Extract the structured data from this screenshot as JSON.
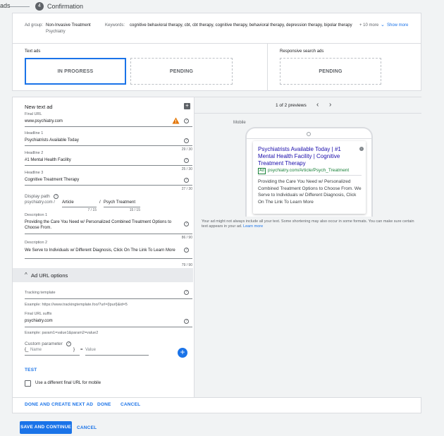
{
  "stepper": {
    "prefix": "ads",
    "step_number": "4",
    "step_label": "Confirmation"
  },
  "ad_group": {
    "label": "Ad group:",
    "name_line1": "Non-Invasive Treatment",
    "name_line2": "Psychiatry",
    "keywords_label": "Keywords:",
    "keywords": "cognitive behavioral therapy, cbt, cbt therapy, cognitive therapy, behavioral therapy, depression therapy, bipolar therapy",
    "more": "+ 10 more",
    "show_more": "Show more"
  },
  "text_ads": {
    "title": "Text ads",
    "in_progress": "IN PROGRESS",
    "pending": "PENDING"
  },
  "responsive_ads": {
    "title": "Responsive search ads",
    "pending": "PENDING"
  },
  "editor": {
    "title": "New text ad",
    "final_url_label": "Final URL",
    "final_url": "www.psychiatry.com",
    "headline1_label": "Headline 1",
    "headline1": "Psychiatrists Available Today",
    "headline1_count": "29 / 30",
    "headline2_label": "Headline 2",
    "headline2": "#1 Mental Health Facility",
    "headline2_count": "25 / 30",
    "headline3_label": "Headline 3",
    "headline3": "Cognitive Treatment Therapy",
    "headline3_count": "27 / 30",
    "display_path_label": "Display path",
    "display_domain": "psychiatry.com /",
    "path1": "Article",
    "path_sep": "/",
    "path2": "Psych Treatment",
    "path1_count": "7 / 15",
    "path2_count": "15 / 15",
    "desc1_label": "Description 1",
    "desc1_line1": "Providing the Care You Need w/ Personalized Combined Treatment Options to",
    "desc1_line2": "Choose From.",
    "desc1_count": "86 / 90",
    "desc2_label": "Description 2",
    "desc2": "We Serve to Individuals w/ Different Diagnosis, Click On The Link To Learn More",
    "desc2_count": "79 / 90",
    "url_options_label": "Ad URL options",
    "tracking_label": "Tracking template",
    "tracking_example": "Example: https://www.trackingtemplate.foo/?url={lpurl}&id=5",
    "suffix_label": "Final URL suffix",
    "suffix_value": "psychiatry.com",
    "suffix_example": "Example: param1=value1&param2=value2",
    "custom_param_label": "Custom parameter",
    "param_open": "{_",
    "param_name_placeholder": "Name",
    "param_close": "}",
    "param_eq": "=",
    "param_value_placeholder": "Value",
    "test": "TEST",
    "mobile_checkbox": "Use a different final URL for mobile"
  },
  "preview": {
    "counter": "1 of 2 previews",
    "device": "Mobile",
    "headline": "Psychiatrists Available Today | #1 Mental Health Facility | Cognitive Treatment Therapy",
    "ad_badge": "Ad",
    "display_url": "psychiatry.com/Article/Psych_Treatment",
    "description": "Providing the Care You Need w/ Personalized Combined Treatment Options to Choose From. We Serve to Individuals w/ Different Diagnosis, Click On The Link To Learn More",
    "disclaimer": "Your ad might not always include all your text. Some shortening may also occur in some formats. You can make sure certain text appears in your ad.",
    "learn_more": "Learn more"
  },
  "card_actions": {
    "done_create_next": "DONE AND CREATE NEXT AD",
    "done": "DONE",
    "cancel": "CANCEL"
  },
  "page_actions": {
    "save_continue": "SAVE AND CONTINUE",
    "cancel": "CANCEL"
  },
  "colors": {
    "primary": "#1a73e8",
    "warning": "#e37400",
    "ad_badge": "#188038"
  }
}
